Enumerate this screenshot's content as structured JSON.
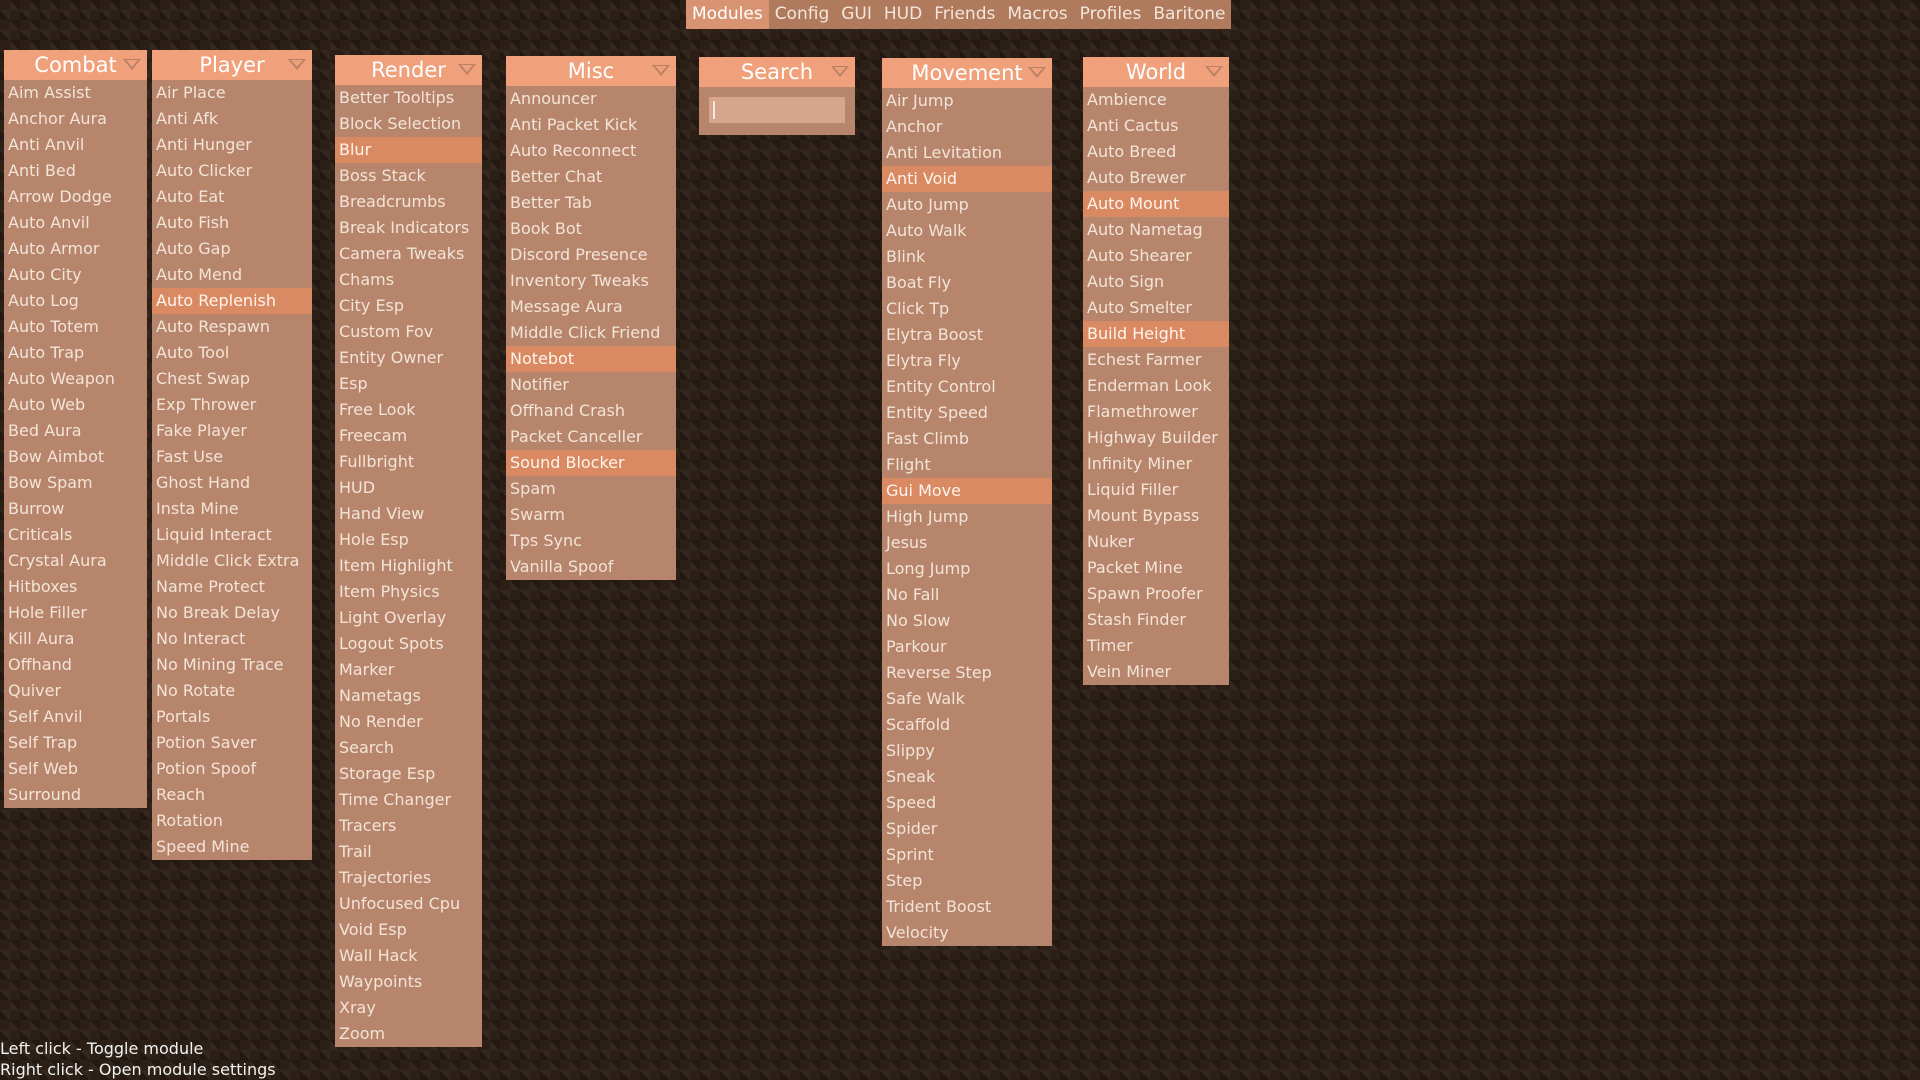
{
  "tabs": [
    "Modules",
    "Config",
    "GUI",
    "HUD",
    "Friends",
    "Macros",
    "Profiles",
    "Baritone"
  ],
  "active_tab": "Modules",
  "panels": {
    "combat": {
      "title": "Combat",
      "items": [
        "Aim Assist",
        "Anchor Aura",
        "Anti Anvil",
        "Anti Bed",
        "Arrow Dodge",
        "Auto Anvil",
        "Auto Armor",
        "Auto City",
        "Auto Log",
        "Auto Totem",
        "Auto Trap",
        "Auto Weapon",
        "Auto Web",
        "Bed Aura",
        "Bow Aimbot",
        "Bow Spam",
        "Burrow",
        "Criticals",
        "Crystal Aura",
        "Hitboxes",
        "Hole Filler",
        "Kill Aura",
        "Offhand",
        "Quiver",
        "Self Anvil",
        "Self Trap",
        "Self Web",
        "Surround"
      ],
      "active": []
    },
    "player": {
      "title": "Player",
      "items": [
        "Air Place",
        "Anti Afk",
        "Anti Hunger",
        "Auto Clicker",
        "Auto Eat",
        "Auto Fish",
        "Auto Gap",
        "Auto Mend",
        "Auto Replenish",
        "Auto Respawn",
        "Auto Tool",
        "Chest Swap",
        "Exp Thrower",
        "Fake Player",
        "Fast Use",
        "Ghost Hand",
        "Insta Mine",
        "Liquid Interact",
        "Middle Click Extra",
        "Name Protect",
        "No Break Delay",
        "No Interact",
        "No Mining Trace",
        "No Rotate",
        "Portals",
        "Potion Saver",
        "Potion Spoof",
        "Reach",
        "Rotation",
        "Speed Mine"
      ],
      "active": [
        "Auto Replenish"
      ]
    },
    "render": {
      "title": "Render",
      "items": [
        "Better Tooltips",
        "Block Selection",
        "Blur",
        "Boss Stack",
        "Breadcrumbs",
        "Break Indicators",
        "Camera Tweaks",
        "Chams",
        "City Esp",
        "Custom Fov",
        "Entity Owner",
        "Esp",
        "Free Look",
        "Freecam",
        "Fullbright",
        "HUD",
        "Hand View",
        "Hole Esp",
        "Item Highlight",
        "Item Physics",
        "Light Overlay",
        "Logout Spots",
        "Marker",
        "Nametags",
        "No Render",
        "Search",
        "Storage Esp",
        "Time Changer",
        "Tracers",
        "Trail",
        "Trajectories",
        "Unfocused Cpu",
        "Void Esp",
        "Wall Hack",
        "Waypoints",
        "Xray",
        "Zoom"
      ],
      "active": [
        "Blur"
      ]
    },
    "misc": {
      "title": "Misc",
      "items": [
        "Announcer",
        "Anti Packet Kick",
        "Auto Reconnect",
        "Better Chat",
        "Better Tab",
        "Book Bot",
        "Discord Presence",
        "Inventory Tweaks",
        "Message Aura",
        "Middle Click Friend",
        "Notebot",
        "Notifier",
        "Offhand Crash",
        "Packet Canceller",
        "Sound Blocker",
        "Spam",
        "Swarm",
        "Tps Sync",
        "Vanilla Spoof"
      ],
      "active": [
        "Notebot",
        "Sound Blocker"
      ]
    },
    "search": {
      "title": "Search",
      "value": ""
    },
    "movement": {
      "title": "Movement",
      "items": [
        "Air Jump",
        "Anchor",
        "Anti Levitation",
        "Anti Void",
        "Auto Jump",
        "Auto Walk",
        "Blink",
        "Boat Fly",
        "Click Tp",
        "Elytra Boost",
        "Elytra Fly",
        "Entity Control",
        "Entity Speed",
        "Fast Climb",
        "Flight",
        "Gui Move",
        "High Jump",
        "Jesus",
        "Long Jump",
        "No Fall",
        "No Slow",
        "Parkour",
        "Reverse Step",
        "Safe Walk",
        "Scaffold",
        "Slippy",
        "Sneak",
        "Speed",
        "Spider",
        "Sprint",
        "Step",
        "Trident Boost",
        "Velocity"
      ],
      "active": [
        "Anti Void",
        "Gui Move"
      ]
    },
    "world": {
      "title": "World",
      "items": [
        "Ambience",
        "Anti Cactus",
        "Auto Breed",
        "Auto Brewer",
        "Auto Mount",
        "Auto Nametag",
        "Auto Shearer",
        "Auto Sign",
        "Auto Smelter",
        "Build Height",
        "Echest Farmer",
        "Enderman Look",
        "Flamethrower",
        "Highway Builder",
        "Infinity Miner",
        "Liquid Filler",
        "Mount Bypass",
        "Nuker",
        "Packet Mine",
        "Spawn Proofer",
        "Stash Finder",
        "Timer",
        "Vein Miner"
      ],
      "active": [
        "Auto Mount",
        "Build Height"
      ]
    }
  },
  "hints": {
    "left": "Left click - Toggle module",
    "right": "Right click - Open module settings"
  }
}
